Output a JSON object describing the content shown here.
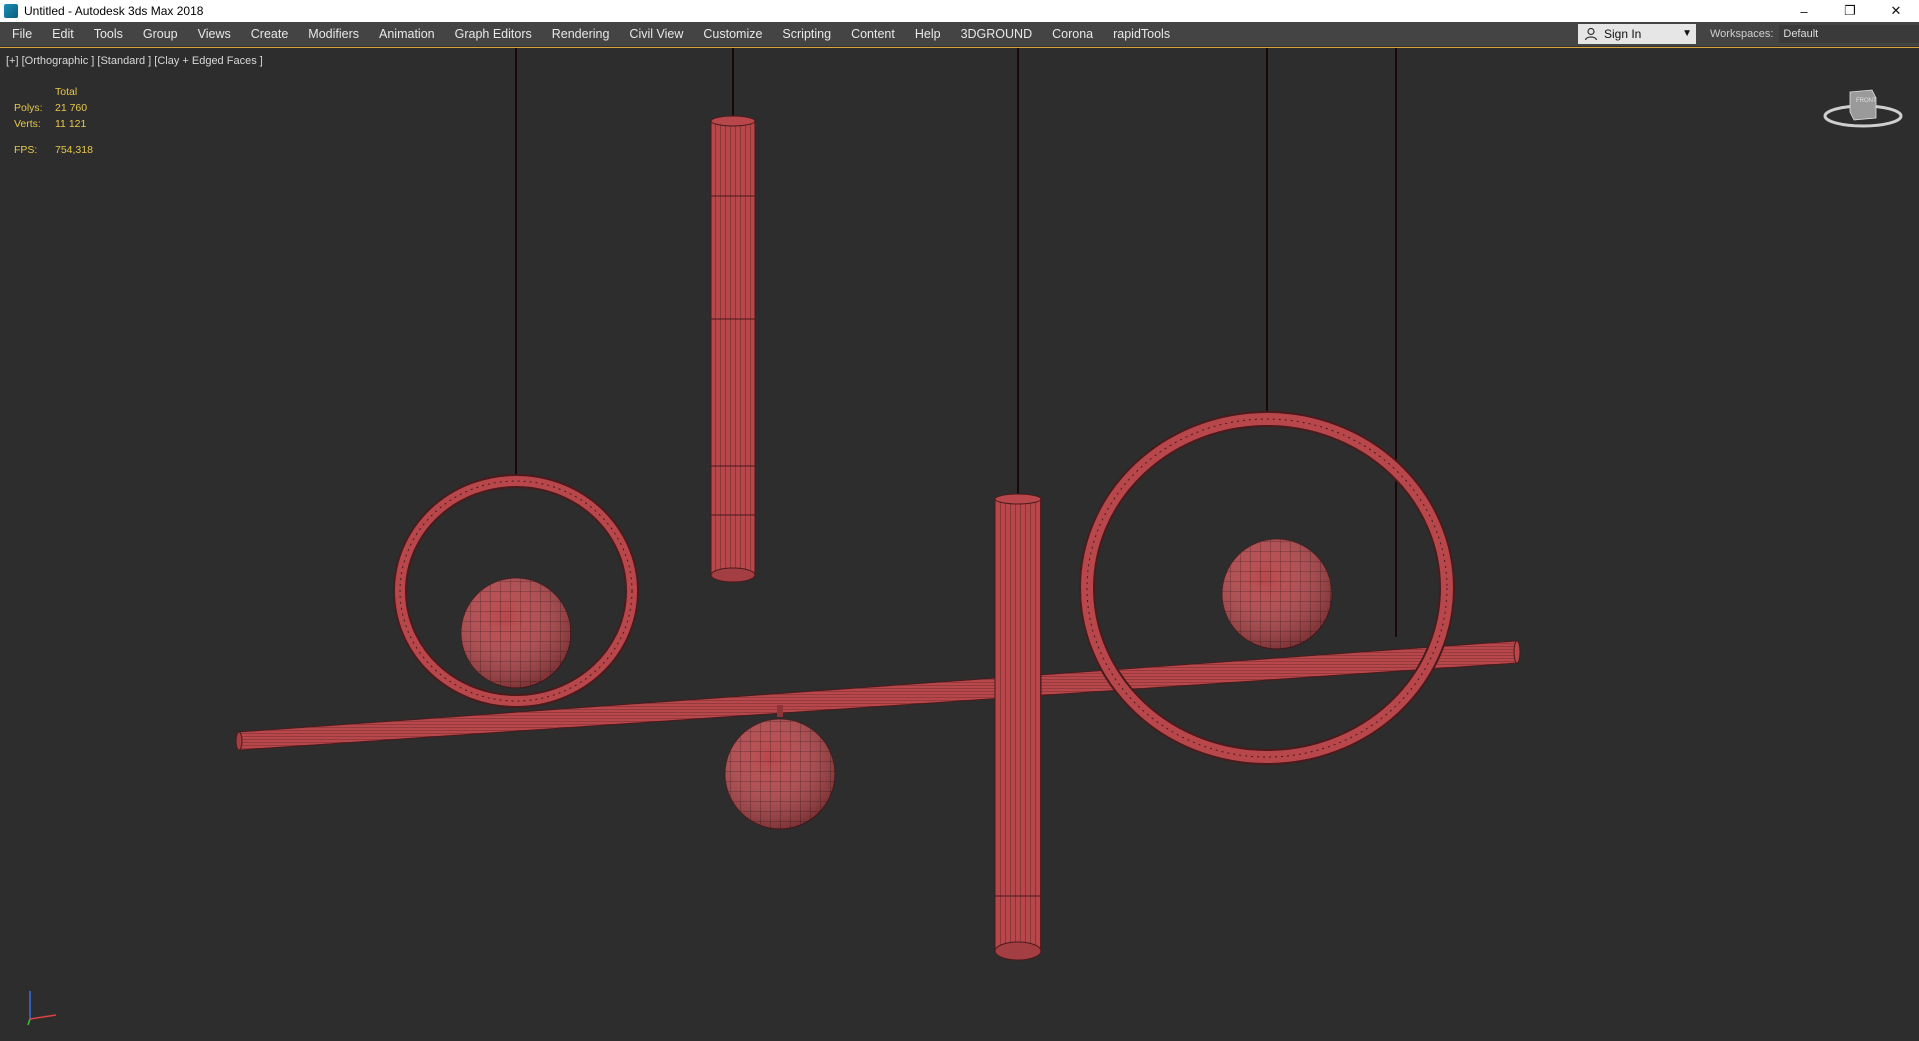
{
  "window": {
    "title": "Untitled - Autodesk 3ds Max 2018",
    "minimize": "–",
    "restore": "❐",
    "close": "✕"
  },
  "menu": [
    "File",
    "Edit",
    "Tools",
    "Group",
    "Views",
    "Create",
    "Modifiers",
    "Animation",
    "Graph Editors",
    "Rendering",
    "Civil View",
    "Customize",
    "Scripting",
    "Content",
    "Help",
    "3DGROUND",
    "Corona",
    "rapidTools"
  ],
  "signin": {
    "label": "Sign In"
  },
  "workspaces": {
    "label": "Workspaces:",
    "value": "Default"
  },
  "viewport": {
    "label": "[+] [Orthographic ] [Standard ] [Clay + Edged Faces ]",
    "stats": {
      "header": "Total",
      "polys_label": "Polys:",
      "polys": "21 760",
      "verts_label": "Verts:",
      "verts": "11 121",
      "fps_label": "FPS:",
      "fps": "754,318"
    },
    "viewcube_face": "FRONT"
  },
  "colors": {
    "accent": "#d9a43a",
    "clay": "#b5474a",
    "wire": "#4a1a1c",
    "stats": "#e8c84a"
  }
}
